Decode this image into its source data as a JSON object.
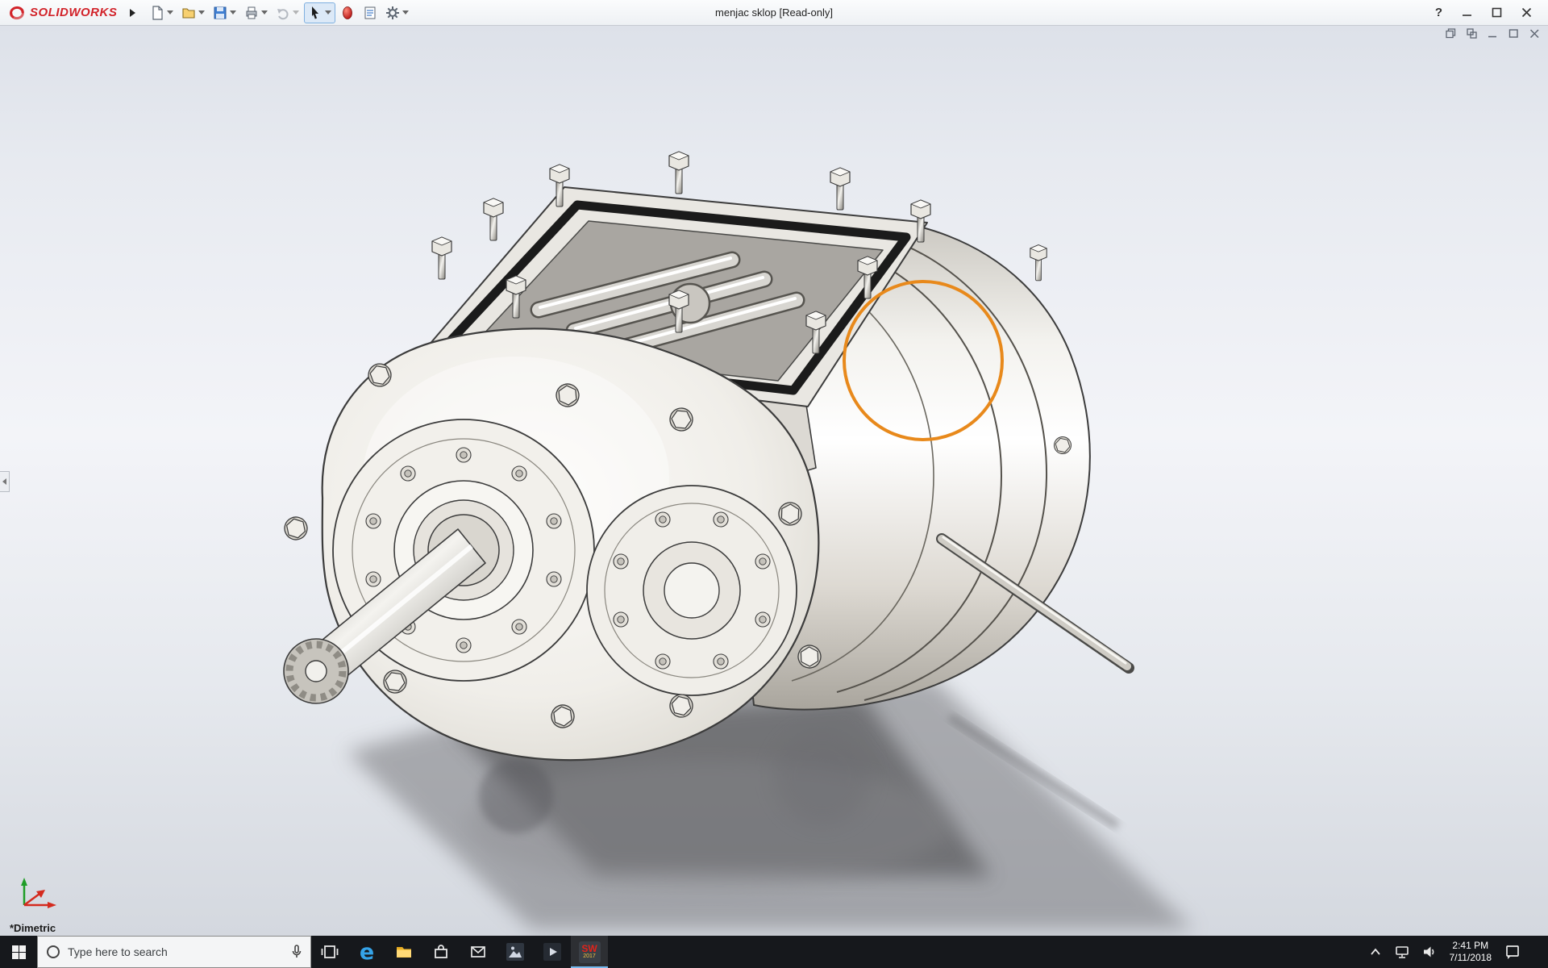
{
  "titlebar": {
    "app_name": "SOLIDWORKS",
    "document_title": "menjac sklop [Read-only]",
    "help_label": "?"
  },
  "toolbar": {
    "items": [
      "new-document",
      "open",
      "save",
      "print",
      "undo",
      "select",
      "appearances",
      "document-properties",
      "options"
    ]
  },
  "document_window": {
    "controls": [
      "windows",
      "cascade",
      "minimize",
      "restore",
      "close"
    ]
  },
  "viewport": {
    "view_label": "*Dimetric",
    "annotation": {
      "shape": "circle",
      "color": "#e8891b"
    }
  },
  "taskbar": {
    "search": {
      "placeholder": "Type here to search"
    },
    "apps": [
      "task-view",
      "edge",
      "file-explorer",
      "store",
      "mail",
      "photos",
      "movies",
      "solidworks"
    ],
    "active_app": "solidworks",
    "edge_glyph": "e",
    "solidworks_glyph": "SW",
    "solidworks_year": "2017",
    "tray": {
      "time": "2:41 PM",
      "date": "7/11/2018"
    }
  },
  "colors": {
    "annotation_orange": "#e8891b",
    "solidworks_red": "#d2232a",
    "taskbar_bg": "#16181c"
  }
}
